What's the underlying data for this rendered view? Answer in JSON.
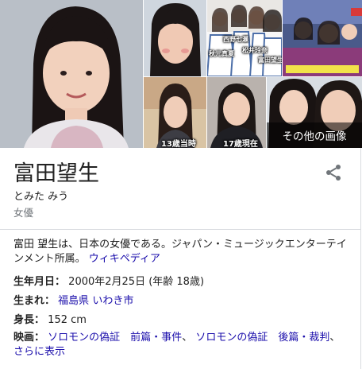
{
  "gallery": {
    "captions": {
      "age13": "13歳当時",
      "age17": "17歳現在"
    },
    "collage_names": [
      "西野七瀬",
      "松井玲奈",
      "秋元真夏",
      "富田望生"
    ],
    "more_images": "その他の画像"
  },
  "entity": {
    "name": "富田望生",
    "reading": "とみた みう",
    "role": "女優"
  },
  "description": {
    "text": "富田 望生は、日本の女優である。ジャパン・ミュージックエンターテインメント所属。",
    "source": "ウィキペディア"
  },
  "facts": {
    "birth": {
      "label": "生年月日",
      "value": "2000年2月25日 (年齢 18歳)"
    },
    "born": {
      "label": "生まれ",
      "link1": "福島県",
      "link2": "いわき市"
    },
    "height": {
      "label": "身長",
      "value": "152 cm"
    },
    "film": {
      "label": "映画",
      "link1": "ソロモンの偽証　前篇・事件",
      "link2": "ソロモンの偽証　後篇・裁判",
      "more": "さらに表示"
    }
  },
  "colors": {
    "link": "#1a0dab",
    "muted": "#70757a",
    "divider": "#dadce0"
  }
}
